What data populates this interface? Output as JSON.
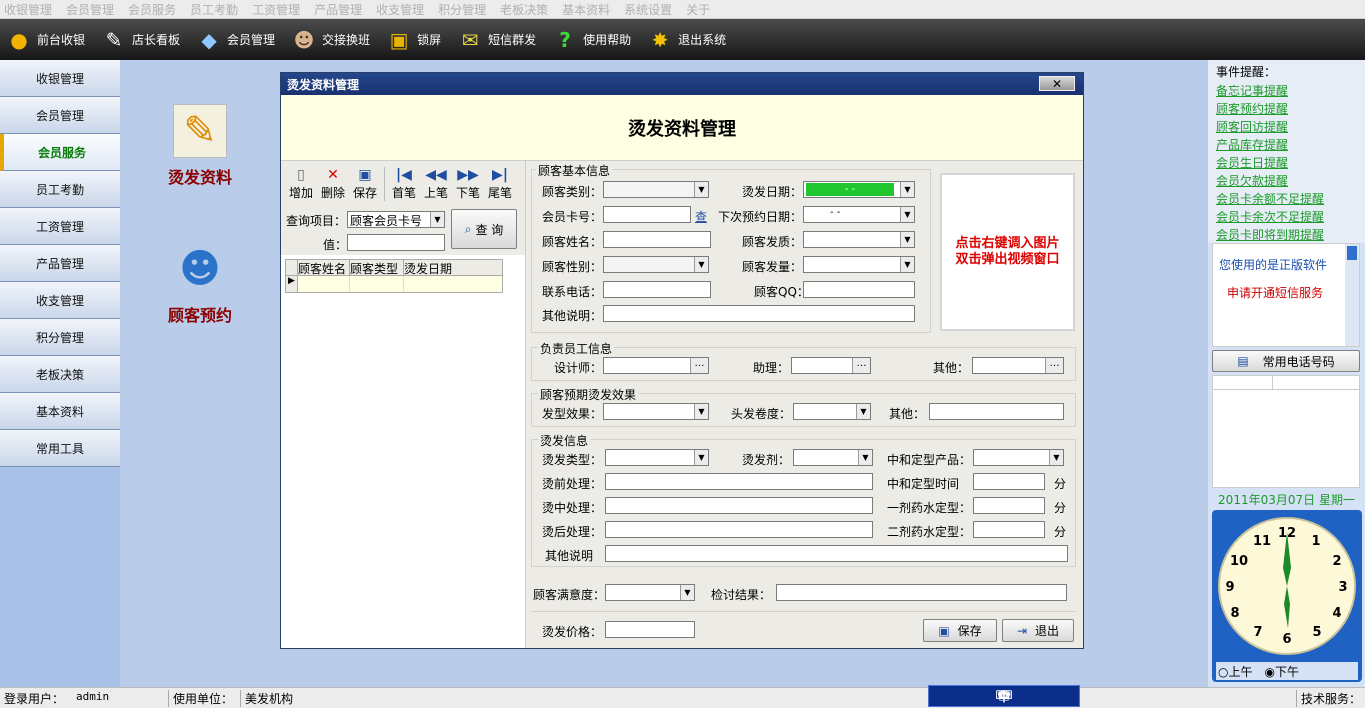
{
  "menubar": [
    "收银管理",
    "会员管理",
    "会员服务",
    "员工考勤",
    "工资管理",
    "产品管理",
    "收支管理",
    "积分管理",
    "老板决策",
    "基本资料",
    "系统设置",
    "关于"
  ],
  "toolbar": [
    {
      "label": "前台收银",
      "icon": "coins-icon"
    },
    {
      "label": "店长看板",
      "icon": "pen-icon"
    },
    {
      "label": "会员管理",
      "icon": "card-icon"
    },
    {
      "label": "交接换班",
      "icon": "user-icon"
    },
    {
      "label": "锁屏",
      "icon": "lock-icon"
    },
    {
      "label": "短信群发",
      "icon": "mail-icon"
    },
    {
      "label": "使用帮助",
      "icon": "question-icon"
    },
    {
      "label": "退出系统",
      "icon": "exit-icon"
    }
  ],
  "sidebar": [
    "收银管理",
    "会员管理",
    "会员服务",
    "员工考勤",
    "工资管理",
    "产品管理",
    "收支管理",
    "积分管理",
    "老板决策",
    "基本资料",
    "常用工具"
  ],
  "sidebar_active": "会员服务",
  "functions": [
    "烫发资料",
    "顾客预约"
  ],
  "dialog": {
    "title": "烫发资料管理",
    "close": "✕",
    "header": "烫发资料管理",
    "tools": {
      "add": "增加",
      "del": "删除",
      "save": "保存",
      "first": "首笔",
      "prev": "上笔",
      "next": "下笔",
      "last": "尾笔"
    },
    "query_item_label": "查询项目：",
    "query_item_value": "顾客会员卡号",
    "query_value_label": "值：",
    "query_button": "查 询",
    "grid_cols": [
      "顾客姓名",
      "顾客类型",
      "烫发日期"
    ],
    "basic": {
      "title": "顾客基本信息",
      "type": "顾客类别：",
      "date": "烫发日期：",
      "date_value": "-  -",
      "card": "会员卡号：",
      "card_check": "查",
      "next_date": "下次预约日期：",
      "next_date_value": "-  -",
      "name": "顾客姓名：",
      "hair": "顾客发质：",
      "sex": "顾客性别：",
      "amount": "顾客发量：",
      "phone": "联系电话：",
      "qq": "顾客QQ：",
      "other": "其他说明："
    },
    "photo_hint": [
      "点击右键调入图片",
      "双击弹出视频窗口"
    ],
    "staff": {
      "title": "负责员工信息",
      "designer": "设计师：",
      "assistant": "助理：",
      "other": "其他："
    },
    "expect": {
      "title": "顾客预期烫发效果",
      "style": "发型效果：",
      "curl": "头发卷度：",
      "other": "其他："
    },
    "perm": {
      "title": "烫发信息",
      "type": "烫发类型：",
      "agent": "烫发剂：",
      "product": "中和定型产品：",
      "before": "烫前处理：",
      "neutral_time": "中和定型时间",
      "during": "烫中处理：",
      "first": "一剂药水定型：",
      "after": "烫后处理：",
      "second": "二剂药水定型：",
      "other": "其他说明",
      "unit": "分"
    },
    "satisfaction": "顾客满意度：",
    "review": "检讨结果：",
    "price": "烫发价格：",
    "save": "保存",
    "exit": "退出"
  },
  "right": {
    "events_title": "事件提醒：",
    "events": [
      "备忘记事提醒",
      "顾客预约提醒",
      "顾客回访提醒",
      "产品库存提醒",
      "会员生日提醒",
      "会员欠款提醒",
      "会员卡余额不足提醒",
      "会员卡余次不足提醒",
      "会员卡即将到期提醒"
    ],
    "notice1": "您使用的是正版软件",
    "notice2": "申请开通短信服务",
    "phonebook": "常用电话号码",
    "date": "2011年03月07日 星期一",
    "am": "上午",
    "pm": "下午"
  },
  "status": {
    "user_label": "登录用户：",
    "user": "admin",
    "unit_label": "使用单位：",
    "unit": "美发机构",
    "ime": "中",
    "tech": "技术服务："
  },
  "colors": {
    "accent": "#1a3170",
    "link": "#1d9a2a",
    "title_red": "#8b0000"
  }
}
